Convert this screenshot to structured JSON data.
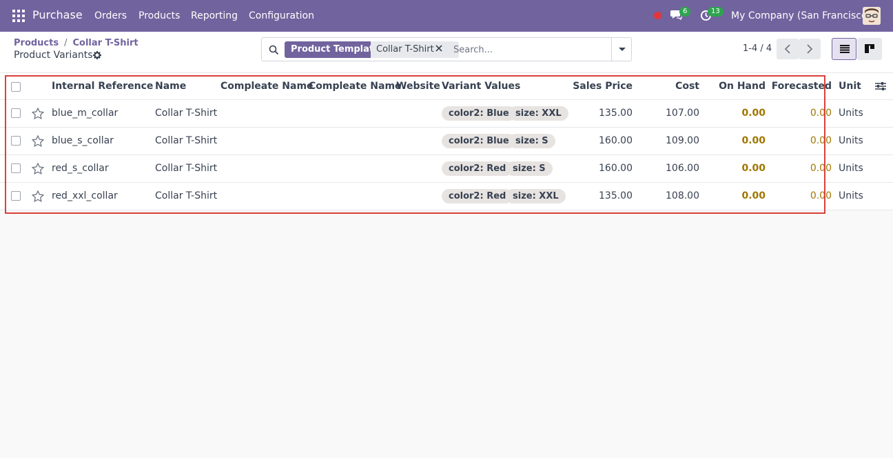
{
  "app": {
    "brand": "Purchase",
    "menu": [
      "Orders",
      "Products",
      "Reporting",
      "Configuration"
    ],
    "messages_count": "6",
    "activities_count": "13",
    "company": "My Company (San Francisco)"
  },
  "breadcrumb": {
    "parent": "Products",
    "separator": "/",
    "current": "Collar T-Shirt"
  },
  "page": {
    "title": "Product Variants"
  },
  "search": {
    "facet_label": "Product Template",
    "facet_value": "Collar T-Shirt",
    "placeholder": "Search..."
  },
  "pager": {
    "value": "1-4 / 4"
  },
  "table": {
    "columns": [
      "Internal Reference",
      "Name",
      "Compleate Name",
      "Compleate Name",
      "Website",
      "Variant Values",
      "Sales Price",
      "Cost",
      "On Hand",
      "Forecasted",
      "Unit"
    ],
    "rows": [
      {
        "ref": "blue_m_collar",
        "name": "Collar T-Shirt",
        "tags": [
          "color2: Blue",
          "size: XXL"
        ],
        "price": "135.00",
        "cost": "107.00",
        "on_hand": "0.00",
        "forecasted": "0.00",
        "unit": "Units"
      },
      {
        "ref": "blue_s_collar",
        "name": "Collar T-Shirt",
        "tags": [
          "color2: Blue",
          "size: S"
        ],
        "price": "160.00",
        "cost": "109.00",
        "on_hand": "0.00",
        "forecasted": "0.00",
        "unit": "Units"
      },
      {
        "ref": "red_s_collar",
        "name": "Collar T-Shirt",
        "tags": [
          "color2: Red",
          "size: S"
        ],
        "price": "160.00",
        "cost": "106.00",
        "on_hand": "0.00",
        "forecasted": "0.00",
        "unit": "Units"
      },
      {
        "ref": "red_xxl_collar",
        "name": "Collar T-Shirt",
        "tags": [
          "color2: Red",
          "size: XXL"
        ],
        "price": "135.00",
        "cost": "108.00",
        "on_hand": "0.00",
        "forecasted": "0.00",
        "unit": "Units"
      }
    ]
  },
  "colors": {
    "brand": "#71639e",
    "highlight_border": "#d9403a",
    "warning_value": "#a07600"
  }
}
